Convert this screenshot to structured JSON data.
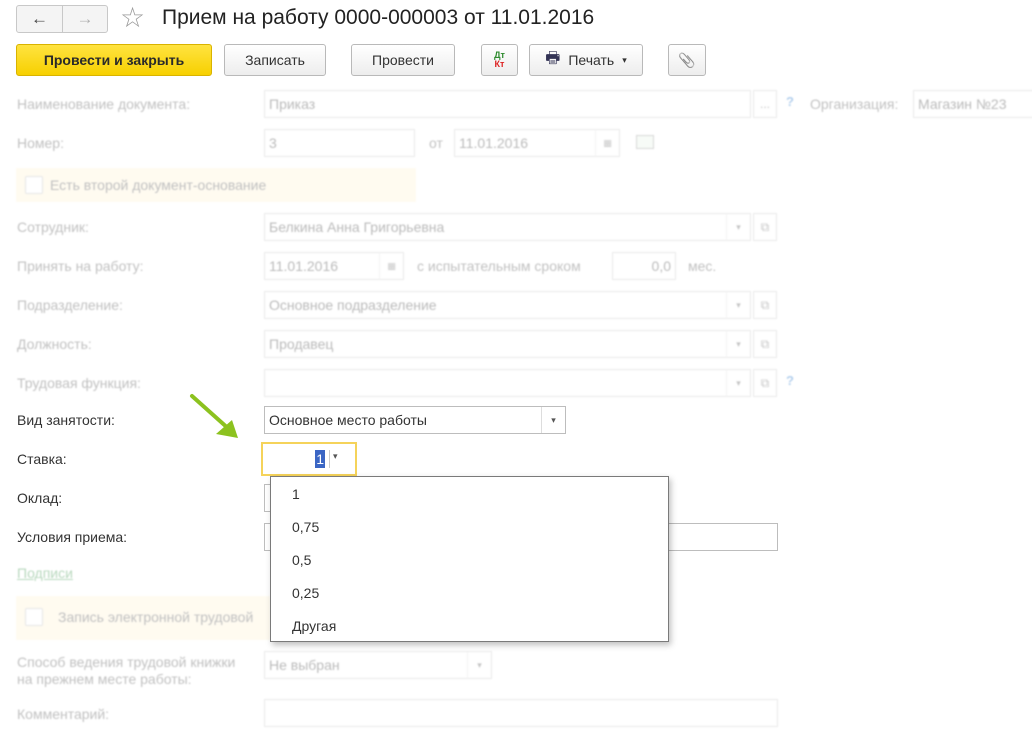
{
  "window": {
    "title": "Прием на работу 0000-000003 от 11.01.2016",
    "back_icon": "←",
    "forward_icon": "→",
    "star_icon": "☆"
  },
  "toolbar": {
    "post_close": "Провести и закрыть",
    "save": "Записать",
    "post": "Провести",
    "dt": "Дт",
    "kt": "Кт",
    "print": "Печать",
    "print_caret": "▾",
    "attach_icon": "📎",
    "printer_icon": "🖶"
  },
  "form": {
    "doc_name": {
      "label": "Наименование документа:",
      "value": "Приказ",
      "btn": "..."
    },
    "organization": {
      "label": "Организация:",
      "value": "Магазин №23"
    },
    "number": {
      "label": "Номер:",
      "value": "3",
      "from_label": "от",
      "date": "11.01.2016"
    },
    "second_doc": {
      "label": "Есть второй документ-основание"
    },
    "employee": {
      "label": "Сотрудник:",
      "value": "Белкина Анна Григорьевна"
    },
    "hire": {
      "label": "Принять на работу:",
      "date": "11.01.2016",
      "probation_label": "с испытательным сроком",
      "probation_value": "0,0",
      "unit": "мес."
    },
    "department": {
      "label": "Подразделение:",
      "value": "Основное подразделение"
    },
    "position": {
      "label": "Должность:",
      "value": "Продавец"
    },
    "labor_function": {
      "label": "Трудовая функция:",
      "value": ""
    },
    "employment_type": {
      "label": "Вид занятости:",
      "value": "Основное место работы"
    },
    "rate": {
      "label": "Ставка:",
      "value": "1"
    },
    "salary": {
      "label": "Оклад:"
    },
    "conditions": {
      "label": "Условия приема:"
    },
    "signatures_link": "Подписи",
    "electronic_book": {
      "label": "Запись электронной трудовой"
    },
    "book_method": {
      "label_line1": "Способ ведения трудовой книжки",
      "label_line2": "на прежнем месте работы:",
      "value": "Не выбран"
    },
    "comment": {
      "label": "Комментарий:"
    },
    "help_mark": "?",
    "caret": "▾",
    "open_icon": "⧉",
    "calendar_icon": "▦"
  },
  "rate_options": [
    "1",
    "0,75",
    "0,5",
    "0,25",
    "Другая"
  ]
}
